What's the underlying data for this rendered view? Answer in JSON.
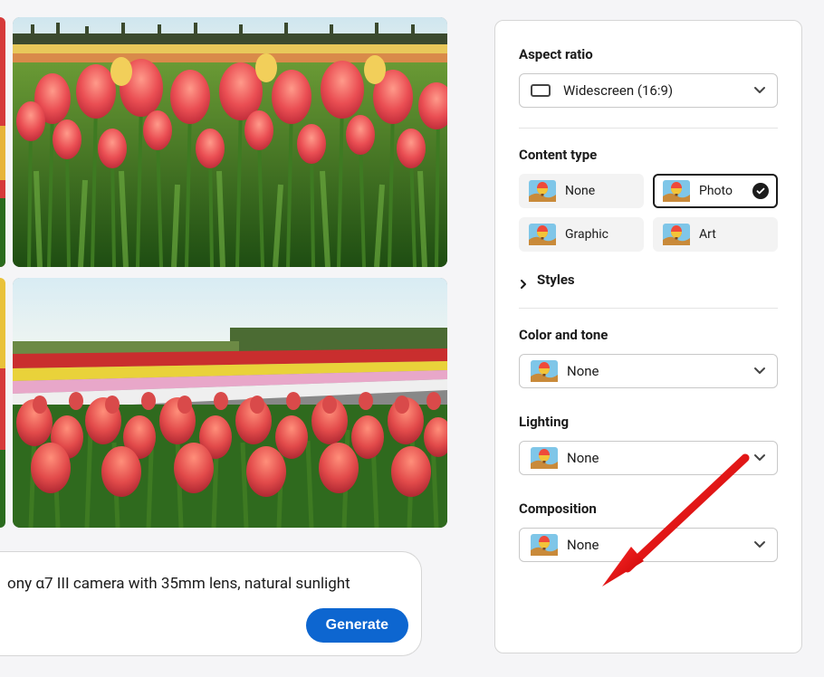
{
  "prompt": {
    "text_visible": "ony α7 III camera with 35mm lens, natural sunlight",
    "generate_label": "Generate"
  },
  "panel": {
    "aspect_ratio": {
      "label": "Aspect ratio",
      "value": "Widescreen (16:9)"
    },
    "content_type": {
      "label": "Content type",
      "options": [
        "None",
        "Photo",
        "Graphic",
        "Art"
      ],
      "selected": "Photo"
    },
    "styles": {
      "label": "Styles"
    },
    "color_tone": {
      "label": "Color and tone",
      "value": "None"
    },
    "lighting": {
      "label": "Lighting",
      "value": "None"
    },
    "composition": {
      "label": "Composition",
      "value": "None"
    }
  }
}
